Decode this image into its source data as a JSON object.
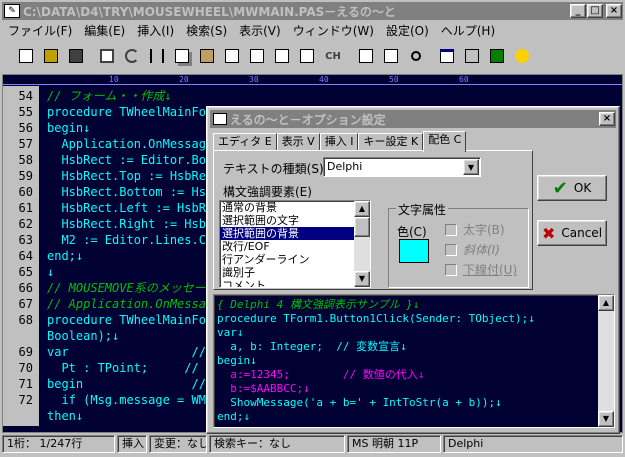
{
  "app": {
    "title": "C:\\DATA\\D4\\TRY\\MOUSEWHEEL\\MWMAIN.PAS－えるの～と"
  },
  "menu": [
    "ファイル(F)",
    "編集(E)",
    "挿入(I)",
    "検索(S)",
    "表示(V)",
    "ウィンドウ(W)",
    "設定(O)",
    "ヘルプ(H)"
  ],
  "toolbar": {
    "ch_label": "CH"
  },
  "ruler": [
    "10",
    "20",
    "30",
    "40",
    "50",
    "60"
  ],
  "editor": {
    "lines": [
      {
        "n": "54",
        "text": "// フォーム・・作成↓",
        "color": "#00c000",
        "italic": true
      },
      {
        "n": "55",
        "text": "procedure TWheelMainForm.FormCreate(Sender: TObject);↓",
        "color": "#00ffff"
      },
      {
        "n": "56",
        "text": "begin↓",
        "color": "#00ffff"
      },
      {
        "n": "57",
        "text": "  Application.OnMessage := AppMessage;↓",
        "color": "#00ffff"
      },
      {
        "n": "58",
        "text": "  HsbRect := Editor.BoundsRect;↓",
        "color": "#00ffff"
      },
      {
        "n": "59",
        "text": "  HsbRect.Top := HsbRect.Bottom;↓",
        "color": "#00ffff"
      },
      {
        "n": "60",
        "text": "  HsbRect.Bottom := HsbRect.Top;↓",
        "color": "#00ffff"
      },
      {
        "n": "61",
        "text": "  HsbRect.Left := HsbRect.Left;↓",
        "color": "#00ffff"
      },
      {
        "n": "62",
        "text": "  HsbRect.Right := HsbRect.Right;↓",
        "color": "#00ffff"
      },
      {
        "n": "63",
        "text": "  M2 := Editor.Lines.Count;↓",
        "color": "#00ffff"
      },
      {
        "n": "64",
        "text": "end;↓",
        "color": "#00ffff"
      },
      {
        "n": "65",
        "text": "↓",
        "color": "#00ffff"
      },
      {
        "n": "66",
        "text": "// MOUSEMOVE系のメッセージ↓",
        "color": "#00c000",
        "italic": true
      },
      {
        "n": "67",
        "text": "// Application.OnMessage↓",
        "color": "#00c000",
        "italic": true
      },
      {
        "n": "68",
        "text": "procedure TWheelMainForm.AppMessage(var Msg: TMsg; var Handled:",
        "color": "#00ffff"
      },
      {
        "n": "",
        "text": "Boolean);↓",
        "color": "#00ffff"
      },
      {
        "n": "69",
        "text": "var                 // 変数宣言↓",
        "color": "#00ffff"
      },
      {
        "n": "70",
        "text": "  Pt : TPoint;     // マウス位置↓",
        "color": "#00ffff"
      },
      {
        "n": "71",
        "text": "begin               // 処理開始↓",
        "color": "#00ffff"
      },
      {
        "n": "72",
        "text": "  if (Msg.message = WM_MOUSEWHEEL) then↓",
        "color": "#00ffff"
      },
      {
        "n": "",
        "text": "then↓",
        "color": "#00ffff"
      }
    ]
  },
  "status": {
    "position": "1桁：  1/247行",
    "mode": "挿入",
    "modified": "変更：なし",
    "searchkey": "検索キー：なし",
    "font": "MS 明朝 11P",
    "language": "Delphi"
  },
  "dialog": {
    "title": "えるの～と－オプション設定",
    "tabs": [
      "エディタ E",
      "表示 V",
      "挿入 I",
      "キー設定 K",
      "配色 C"
    ],
    "active_tab_index": 4,
    "text_type_label": "テキストの種類(S)",
    "text_type_value": "Delphi",
    "elements_label": "構文強調要素(E)",
    "elements": [
      "通常の背景",
      "選択範囲の文字",
      "選択範囲の背景",
      "改行/EOF",
      "行アンダーライン",
      "識別子",
      "コメント"
    ],
    "selected_element_index": 2,
    "attr_group_label": "文字属性",
    "color_label": "色(C)",
    "color_value": "#00ffff",
    "bold_label": "太字(B)",
    "italic_label": "斜体(I)",
    "underline_label": "下線付(U)",
    "ok_label": "OK",
    "cancel_label": "Cancel",
    "preview": [
      {
        "text": "{ Delphi 4 構文強調表示サンプル }↓",
        "color": "#00c000",
        "italic": true,
        "bg": "#ffffff"
      },
      {
        "text": "procedure TForm1.Button1Click(Sender: TObject);↓",
        "color": "#00ffff"
      },
      {
        "text": "var↓",
        "color": "#00ffff"
      },
      {
        "text": "  a, b: Integer;  // 変数宣言↓",
        "color": "#00ffff"
      },
      {
        "text": "begin↓",
        "color": "#00ffff"
      },
      {
        "text": "  a:=12345;        // 数値の代入↓",
        "color": "#ff00ff"
      },
      {
        "text": "  b:=$AABBCC;↓",
        "color": "#ff00ff"
      },
      {
        "text": "  ShowMessage('a + b=' + IntToStr(a + b));↓",
        "color": "#00ffff"
      },
      {
        "text": "end;↓",
        "color": "#00ffff"
      }
    ]
  }
}
